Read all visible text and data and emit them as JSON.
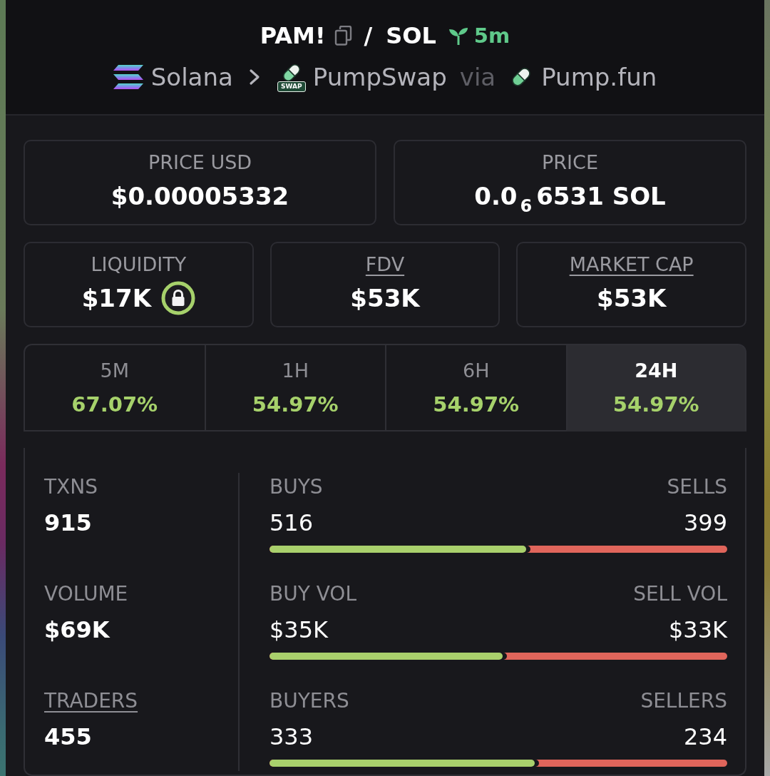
{
  "pair": {
    "base": "PAM!",
    "separator": "/",
    "quote": "SOL",
    "age": "5m"
  },
  "route": {
    "chain": "Solana",
    "dex": "PumpSwap",
    "dex_badge": "SWAP",
    "via": "via",
    "launchpad": "Pump.fun"
  },
  "price_cards": [
    {
      "label": "PRICE USD",
      "value": "$0.00005332"
    },
    {
      "label": "PRICE",
      "value": "0.0$_{6}$6531 SOL"
    }
  ],
  "stat_cards": [
    {
      "label": "LIQUIDITY",
      "value": "$17K",
      "underlined": false,
      "locked": true
    },
    {
      "label": "FDV",
      "value": "$53K",
      "underlined": true,
      "locked": false
    },
    {
      "label": "MARKET CAP",
      "value": "$53K",
      "underlined": true,
      "locked": false
    }
  ],
  "tabs": [
    {
      "label": "5M",
      "change": "67.07%",
      "selected": false
    },
    {
      "label": "1H",
      "change": "54.97%",
      "selected": false
    },
    {
      "label": "6H",
      "change": "54.97%",
      "selected": false
    },
    {
      "label": "24H",
      "change": "54.97%",
      "selected": true
    }
  ],
  "totals": [
    {
      "label": "TXNS",
      "value": "915",
      "underlined": false
    },
    {
      "label": "VOLUME",
      "value": "$69K",
      "underlined": false
    },
    {
      "label": "TRADERS",
      "value": "455",
      "underlined": true
    }
  ],
  "splits": [
    {
      "buy_label": "BUYS",
      "buy_value": "516",
      "sell_label": "SELLS",
      "sell_value": "399",
      "level": 0.56
    },
    {
      "buy_label": "BUY VOL",
      "buy_value": "$35K",
      "sell_label": "SELL VOL",
      "sell_value": "$33K",
      "level": 0.51
    },
    {
      "buy_label": "BUYERS",
      "buy_value": "333",
      "sell_label": "SELLERS",
      "sell_value": "234",
      "level": 0.58
    }
  ]
}
